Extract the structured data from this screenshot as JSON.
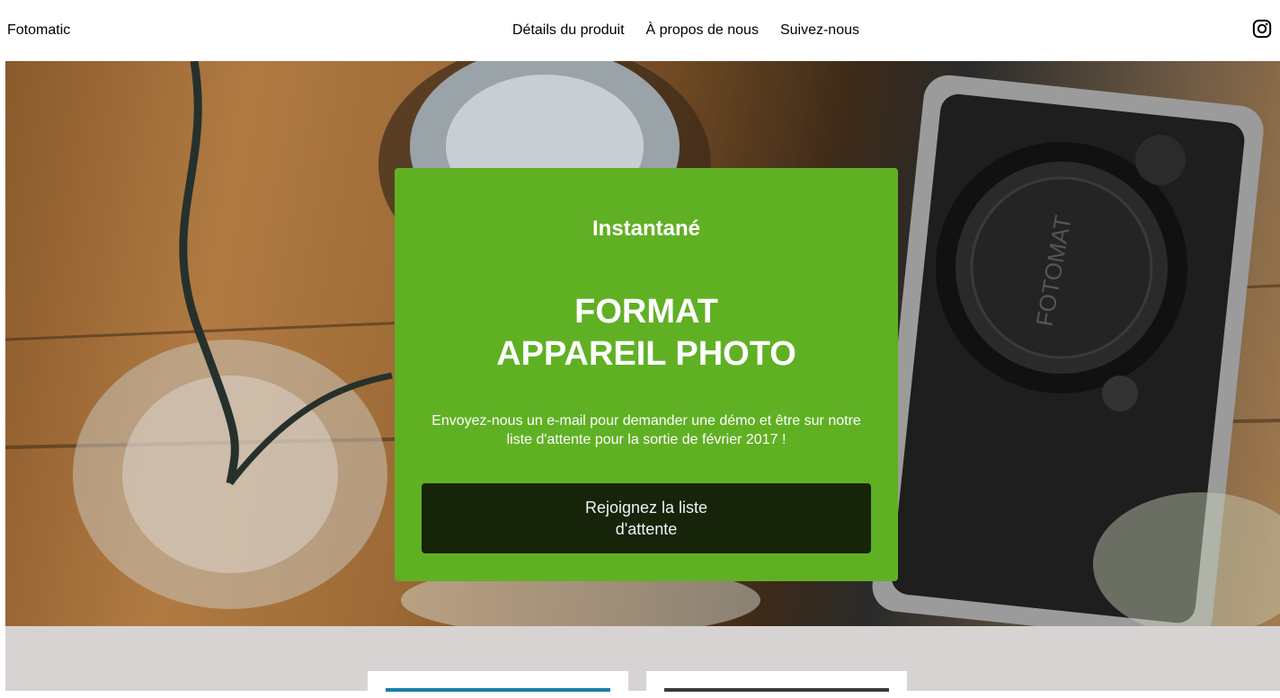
{
  "header": {
    "brand": "Fotomatic",
    "nav": [
      "Détails du produit",
      "À propos de nous",
      "Suivez-nous"
    ],
    "social_icon": "instagram-icon"
  },
  "hero": {
    "kicker": "Instantané",
    "title_line1": "FORMAT",
    "title_line2": "APPAREIL PHOTO",
    "description": "Envoyez-nous un e-mail pour demander une démo et être sur notre liste d'attente pour la sortie de février 2017 !",
    "cta_label": "Rejoignez la liste d'attente",
    "camera_cap_text": "FOTOMAT",
    "card_color": "#60b024",
    "button_color": "#16240a"
  },
  "lower": {
    "background": "#d7d3d3"
  }
}
